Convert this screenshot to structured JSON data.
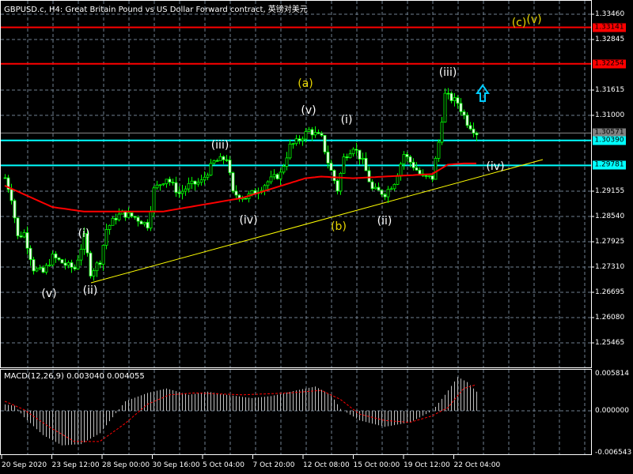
{
  "header": {
    "title": "GBPUSD.c, H4:  Great Britain Pound vs US Dollar Forward contract, 英镑对美元"
  },
  "colors": {
    "bull": "#00ff00",
    "bear": "#ffffff",
    "ma": "#ff0000",
    "resistance": "#ff0000",
    "support": "#00ffff",
    "trend": "#ffff00",
    "grid": "#708090",
    "hist": "#c0c0c0"
  },
  "price_axis": {
    "ticks": [
      "1.33460",
      "1.32845",
      "1.31615",
      "1.31000",
      "1.29155",
      "1.28540",
      "1.27925",
      "1.27310",
      "1.26695",
      "1.26080",
      "1.25465"
    ],
    "range": [
      1.25465,
      1.3346
    ]
  },
  "levels": [
    {
      "label": "1.33141",
      "kind": "resistance"
    },
    {
      "label": "1.32254",
      "kind": "resistance"
    },
    {
      "label": "1.30571",
      "kind": "bid"
    },
    {
      "label": "1.30390",
      "kind": "support"
    },
    {
      "label": "1.29781",
      "kind": "support"
    }
  ],
  "time_axis": [
    "20 Sep 2020",
    "23 Sep 12:00",
    "28 Sep 00:00",
    "30 Sep 16:00",
    "5 Oct 04:00",
    "7 Oct 20:00",
    "12 Oct 08:00",
    "15 Oct 00:00",
    "19 Oct 12:00",
    "22 Oct 04:00"
  ],
  "chart_data": {
    "type": "candlestick",
    "symbol": "GBPUSD.c",
    "timeframe": "H4",
    "close_waypoints": {
      "bar": [
        0,
        2,
        4,
        6,
        9,
        12,
        15,
        19,
        22,
        25,
        27,
        30,
        32,
        35,
        37,
        41,
        45,
        47,
        51,
        55,
        58,
        62,
        66,
        70,
        72,
        76,
        80,
        83,
        87,
        90,
        92,
        96,
        100,
        102,
        105,
        107,
        110,
        113,
        116,
        120,
        123,
        126,
        129,
        132,
        135,
        137,
        139,
        141,
        143,
        146,
        149
      ],
      "close": [
        1.29482,
        1.29001,
        1.2804,
        1.28136,
        1.27271,
        1.27175,
        1.2756,
        1.27367,
        1.27271,
        1.2804,
        1.27175,
        1.27464,
        1.28232,
        1.2852,
        1.28617,
        1.2852,
        1.28328,
        1.29193,
        1.29482,
        1.29097,
        1.29289,
        1.29385,
        1.29866,
        1.29962,
        1.29097,
        1.29001,
        1.29193,
        1.29385,
        1.29578,
        1.3025,
        1.30346,
        1.30635,
        1.30443,
        1.29866,
        1.29193,
        1.29962,
        1.3025,
        1.29866,
        1.29193,
        1.29097,
        1.29385,
        1.30058,
        1.2977,
        1.29482,
        1.29482,
        1.30346,
        1.315,
        1.31404,
        1.31308,
        1.30827,
        1.30571
      ]
    },
    "ma": {
      "bar": [
        0,
        15,
        25,
        50,
        75,
        95,
        100,
        110,
        120,
        135,
        140,
        145,
        149
      ],
      "value": [
        1.2929,
        1.2877,
        1.2866,
        1.2866,
        1.2899,
        1.2947,
        1.2951,
        1.2947,
        1.2951,
        1.2957,
        1.298,
        1.2983,
        1.2983
      ]
    },
    "macd": {
      "title": "MACD(12,26,9) 0.003040 0.004055",
      "range": [
        -0.006543,
        0.005814
      ],
      "ticks": [
        "0.005814",
        "0.000000",
        "-0.006543"
      ],
      "hist_waypoints": {
        "bar": [
          0,
          3,
          6,
          12,
          18,
          24,
          30,
          34,
          38,
          45,
          51,
          58,
          64,
          70,
          78,
          84,
          92,
          98,
          103,
          106,
          112,
          120,
          128,
          135,
          139,
          143,
          146,
          149
        ],
        "value": [
          0.001,
          0.0008,
          -0.001,
          -0.0038,
          -0.0054,
          -0.0052,
          -0.0035,
          -0.001,
          0.0015,
          0.0028,
          0.0035,
          0.0025,
          0.003,
          0.0025,
          0.002,
          0.0023,
          0.0032,
          0.0038,
          0.0025,
          0.0003,
          -0.0015,
          -0.0025,
          -0.0018,
          0.0,
          0.0025,
          0.0053,
          0.0045,
          0.003
        ]
      },
      "signal_waypoints": {
        "bar": [
          0,
          6,
          14,
          22,
          30,
          38,
          45,
          52,
          60,
          75,
          90,
          100,
          106,
          112,
          120,
          128,
          135,
          140,
          145,
          149
        ],
        "value": [
          0.0015,
          0.0002,
          -0.0025,
          -0.0048,
          -0.0048,
          -0.002,
          0.001,
          0.0025,
          0.0028,
          0.0025,
          0.0028,
          0.0032,
          0.0018,
          -0.0005,
          -0.0015,
          -0.0018,
          -0.0008,
          0.0005,
          0.0035,
          0.0041
        ]
      }
    }
  },
  "annotations": {
    "wave_v1": "(v)",
    "wave_ii1": "(ii)",
    "wave_i1": "(i)",
    "wave_iii1": "(iii)",
    "wave_iv1": "(iv)",
    "wave_v2": "(v)",
    "wave_a": "(a)",
    "wave_i2": "(i)",
    "wave_b": "(b)",
    "wave_ii2": "(ii)",
    "wave_iii2": "(iii)",
    "wave_iv2": "(iv)",
    "wave_c": "(c)",
    "wave_v3": "(v)"
  }
}
